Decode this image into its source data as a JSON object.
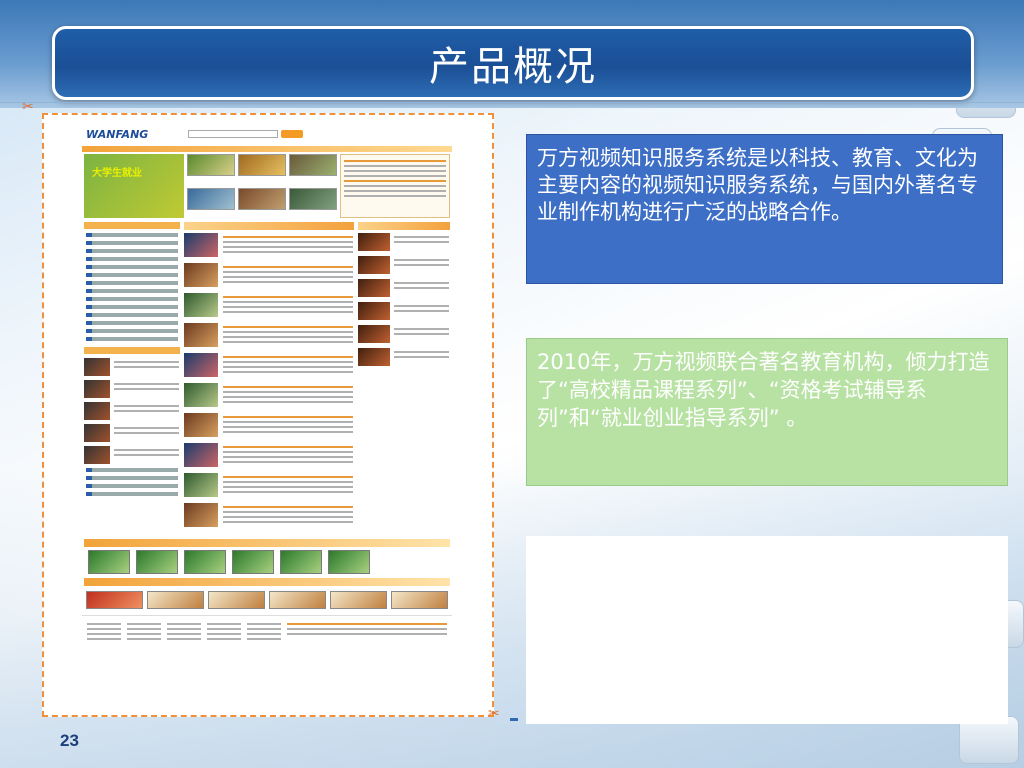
{
  "slide": {
    "title": "产品概况",
    "page_number": "23",
    "colors": {
      "title_bar": "#1f5ea8",
      "blue_box": "#3d6fc6",
      "green_box": "#b8e2a4",
      "frame_dash": "#f0903a"
    }
  },
  "screenshot": {
    "logo": "WANFANG",
    "hero_text": "大学生就业"
  },
  "boxes": {
    "intro": "万方视频知识服务系统是以科技、教育、文化为主要内容的视频知识服务系统，与国内外著名专业制作机构进行广泛的战略合作。",
    "cooperation": "2010年，万方视频联合著名教育机构，倾力打造了“高校精品课程系列”、“资格考试辅导系列”和“就业创业指导系列” 。"
  },
  "icons": {
    "scissor": "scissor-icon"
  }
}
